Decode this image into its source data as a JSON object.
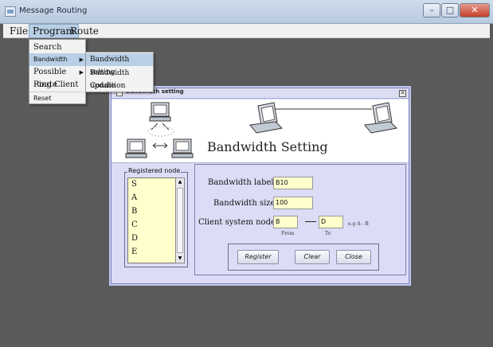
{
  "window": {
    "title": "Message Routing"
  },
  "menubar": {
    "file": "File",
    "program": "Program",
    "route": "Route"
  },
  "program_menu": {
    "search": "Search",
    "bandwidth": "Bandwidth",
    "possible_route": "Possible Route",
    "ping_client": "Ping Client",
    "reset": "Reset"
  },
  "bandwidth_submenu": {
    "setting": "Bandwidth setting",
    "update": "Bandwidth update",
    "condition": "Condition"
  },
  "dialog": {
    "title": "Bandwidth setting",
    "banner_title": "Bandwidth Setting",
    "registered_legend": "Registered node",
    "registered_nodes": [
      "S",
      "A",
      "B",
      "C",
      "D",
      "E"
    ],
    "bandwidth_label_label": "Bandwidth label",
    "bandwidth_label_value": "B10",
    "bandwidth_size_label": "Bandwidth size",
    "bandwidth_size_value": "100",
    "client_node_label": "Client system node",
    "from_value": "B",
    "to_value": "D",
    "from_caption": "From",
    "to_caption": "To",
    "example_hint": "e.g A - B",
    "register_button": "Register",
    "clear_button": "Clear",
    "close_button": "Close"
  },
  "colors": {
    "dialog_bg": "#dcdcf6",
    "field_bg": "#ffffcc",
    "menu_highlight": "#b8cfe5"
  }
}
